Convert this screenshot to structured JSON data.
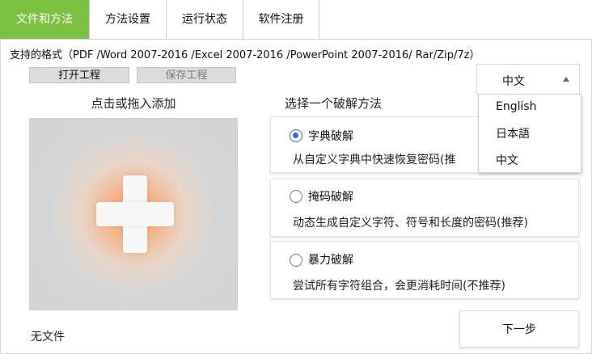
{
  "tabs": [
    {
      "label": "文件和方法",
      "active": true
    },
    {
      "label": "方法设置",
      "active": false
    },
    {
      "label": "运行状态",
      "active": false
    },
    {
      "label": "软件注册",
      "active": false
    }
  ],
  "formats_text": "支持的格式（PDF /Word 2007-2016 /Excel 2007-2016 /PowerPoint 2007-2016/ Rar/Zip/7z）",
  "toolbar": {
    "open_label": "打开工程",
    "save_label": "保存工程"
  },
  "dropzone": {
    "title": "点击或拖入添加",
    "icon": "plus-icon"
  },
  "file_status": "无文件",
  "methods": {
    "title": "选择一个破解方法",
    "items": [
      {
        "name": "字典破解",
        "desc": "从自定义字典中快速恢复密码(推",
        "selected": true
      },
      {
        "name": "掩码破解",
        "desc": "动态生成自定义字符、符号和长度的密码(推荐)",
        "selected": false
      },
      {
        "name": "暴力破解",
        "desc": "尝试所有字符组合，会更消耗时间(不推荐)",
        "selected": false
      }
    ]
  },
  "language": {
    "selected": "中文",
    "options": [
      "English",
      "日本語",
      "中文"
    ]
  },
  "next_label": "下一步",
  "colors": {
    "accent": "#7cc242",
    "radio": "#3a6cc8"
  }
}
